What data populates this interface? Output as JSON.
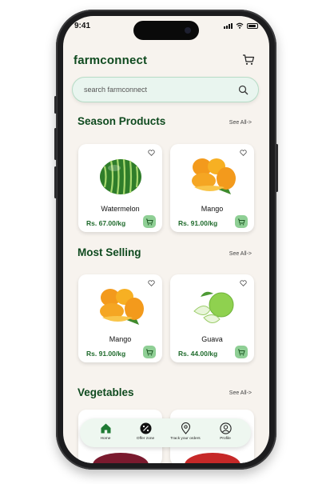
{
  "status": {
    "time": "9:41"
  },
  "app": {
    "brand": "farmconnect"
  },
  "search": {
    "placeholder": "search farmconnect"
  },
  "sections": [
    {
      "title": "Season Products",
      "see_all": "See All->",
      "products": [
        {
          "name": "Watermelon",
          "price": "Rs. 67.00/kg",
          "image": "watermelon-image"
        },
        {
          "name": "Mango",
          "price": "Rs. 91.00/kg",
          "image": "mango-image"
        }
      ]
    },
    {
      "title": "Most Selling",
      "see_all": "See All->",
      "products": [
        {
          "name": "Mango",
          "price": "Rs. 91.00/kg",
          "image": "mango-image"
        },
        {
          "name": "Guava",
          "price": "Rs. 44.00/kg",
          "image": "guava-image"
        }
      ]
    },
    {
      "title": "Vegetables",
      "see_all": "See All->",
      "products": []
    }
  ],
  "nav": [
    {
      "label": "Home",
      "icon": "home-icon"
    },
    {
      "label": "Offer zone",
      "icon": "percent-icon"
    },
    {
      "label": "Track your orders",
      "icon": "location-pin-icon"
    },
    {
      "label": "Profile",
      "icon": "profile-icon"
    }
  ],
  "colors": {
    "brand": "#0f4a1f",
    "accent": "#8fcf95",
    "price": "#1f6b2c",
    "background": "#f7f3ee"
  }
}
